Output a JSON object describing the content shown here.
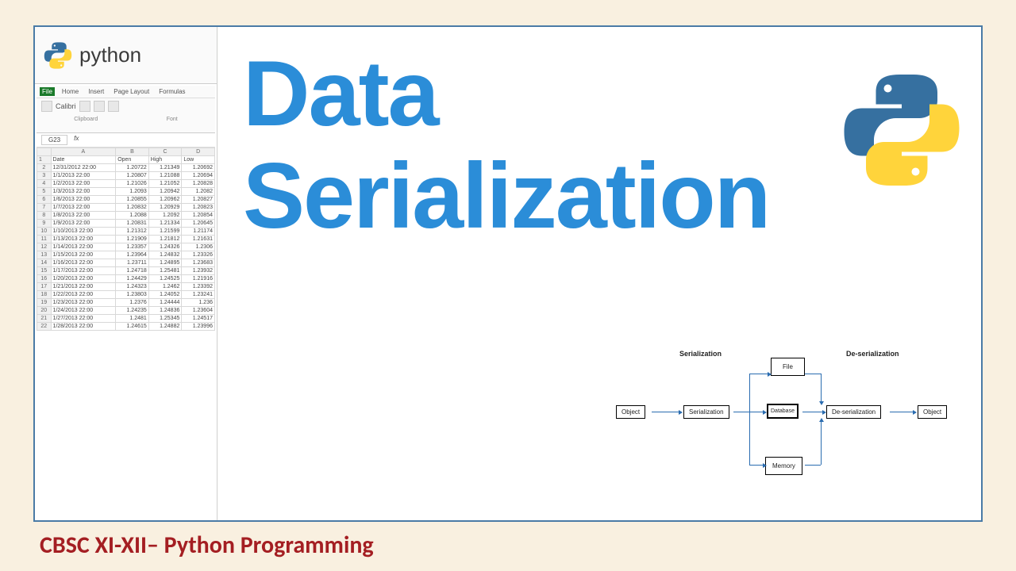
{
  "header": {
    "python_label": "python"
  },
  "excel": {
    "tabs": [
      "File",
      "Home",
      "Insert",
      "Page Layout",
      "Formulas"
    ],
    "font_name": "Calibri",
    "sections": [
      "Clipboard",
      "Font"
    ],
    "active_cell": "G23",
    "fx": "fx",
    "col_letters": [
      "A",
      "B",
      "C",
      "D"
    ],
    "headers": [
      "Date",
      "Open",
      "High",
      "Low"
    ],
    "rows": [
      {
        "n": 2,
        "d": "12/31/2012 22:00",
        "o": "1.20722",
        "h": "1.21349",
        "l": "1.20692"
      },
      {
        "n": 3,
        "d": "1/1/2013 22:00",
        "o": "1.20807",
        "h": "1.21088",
        "l": "1.20694"
      },
      {
        "n": 4,
        "d": "1/2/2013 22:00",
        "o": "1.21026",
        "h": "1.21052",
        "l": "1.20828"
      },
      {
        "n": 5,
        "d": "1/3/2013 22:00",
        "o": "1.2093",
        "h": "1.20942",
        "l": "1.2082"
      },
      {
        "n": 6,
        "d": "1/6/2013 22:00",
        "o": "1.20855",
        "h": "1.20962",
        "l": "1.20827"
      },
      {
        "n": 7,
        "d": "1/7/2013 22:00",
        "o": "1.20832",
        "h": "1.20929",
        "l": "1.20823"
      },
      {
        "n": 8,
        "d": "1/8/2013 22:00",
        "o": "1.2088",
        "h": "1.2092",
        "l": "1.20854"
      },
      {
        "n": 9,
        "d": "1/9/2013 22:00",
        "o": "1.20831",
        "h": "1.21334",
        "l": "1.20645"
      },
      {
        "n": 10,
        "d": "1/10/2013 22:00",
        "o": "1.21312",
        "h": "1.21599",
        "l": "1.21174"
      },
      {
        "n": 11,
        "d": "1/13/2013 22:00",
        "o": "1.21909",
        "h": "1.21812",
        "l": "1.21631"
      },
      {
        "n": 12,
        "d": "1/14/2013 22:00",
        "o": "1.23357",
        "h": "1.24326",
        "l": "1.2306"
      },
      {
        "n": 13,
        "d": "1/15/2013 22:00",
        "o": "1.23964",
        "h": "1.24832",
        "l": "1.23326"
      },
      {
        "n": 14,
        "d": "1/16/2013 22:00",
        "o": "1.23711",
        "h": "1.24895",
        "l": "1.23683"
      },
      {
        "n": 15,
        "d": "1/17/2013 22:00",
        "o": "1.24718",
        "h": "1.25481",
        "l": "1.23932"
      },
      {
        "n": 16,
        "d": "1/20/2013 22:00",
        "o": "1.24429",
        "h": "1.24525",
        "l": "1.21916"
      },
      {
        "n": 17,
        "d": "1/21/2013 22:00",
        "o": "1.24323",
        "h": "1.2462",
        "l": "1.23392"
      },
      {
        "n": 18,
        "d": "1/22/2013 22:00",
        "o": "1.23803",
        "h": "1.24052",
        "l": "1.23241"
      },
      {
        "n": 19,
        "d": "1/23/2013 22:00",
        "o": "1.2376",
        "h": "1.24444",
        "l": "1.236"
      },
      {
        "n": 20,
        "d": "1/24/2013 22:00",
        "o": "1.24235",
        "h": "1.24836",
        "l": "1.23604"
      },
      {
        "n": 21,
        "d": "1/27/2013 22:00",
        "o": "1.2481",
        "h": "1.25345",
        "l": "1.24517"
      },
      {
        "n": 22,
        "d": "1/28/2013 22:00",
        "o": "1.24615",
        "h": "1.24882",
        "l": "1.23996"
      }
    ]
  },
  "main": {
    "title_line1": "Data",
    "title_line2": "Serialization"
  },
  "diagram": {
    "section_left": "Serialization",
    "section_right": "De-serialization",
    "object_left": "Object",
    "serialization": "Serialization",
    "database": "Database",
    "deserialization": "De-serialization",
    "object_right": "Object",
    "file": "File",
    "memory": "Memory"
  },
  "footer": {
    "text": "CBSC XI-XII– Python Programming"
  }
}
